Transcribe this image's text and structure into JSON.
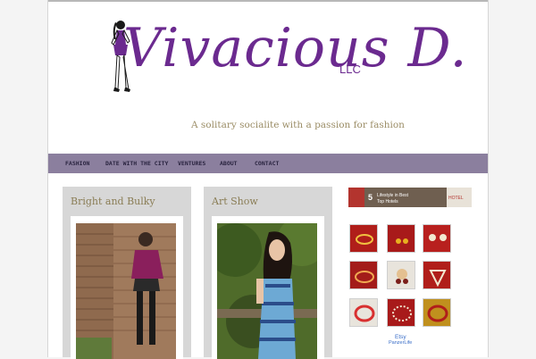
{
  "site": {
    "logo_text": "Vivacious D.",
    "logo_suffix": "LLC",
    "tagline": "A solitary socialite with a passion for fashion"
  },
  "nav": {
    "items": [
      {
        "label": "FASHION"
      },
      {
        "label": "DATE WITH THE CITY"
      },
      {
        "label": "VENTURES"
      },
      {
        "label": "ABOUT"
      },
      {
        "label": "CONTACT"
      }
    ]
  },
  "posts": [
    {
      "title": "Bright and Bulky"
    },
    {
      "title": "Art Show"
    }
  ],
  "sidebar": {
    "banner_text": "5 Lifestyle in Best Top Hotels",
    "etsy_label": "Etsy",
    "etsy_shop": "PanzerLife"
  },
  "colors": {
    "accent": "#6b2a8f",
    "nav_bg": "#8b7f9e",
    "tagline": "#9b8d66",
    "post_bg": "#d7d7d7"
  }
}
